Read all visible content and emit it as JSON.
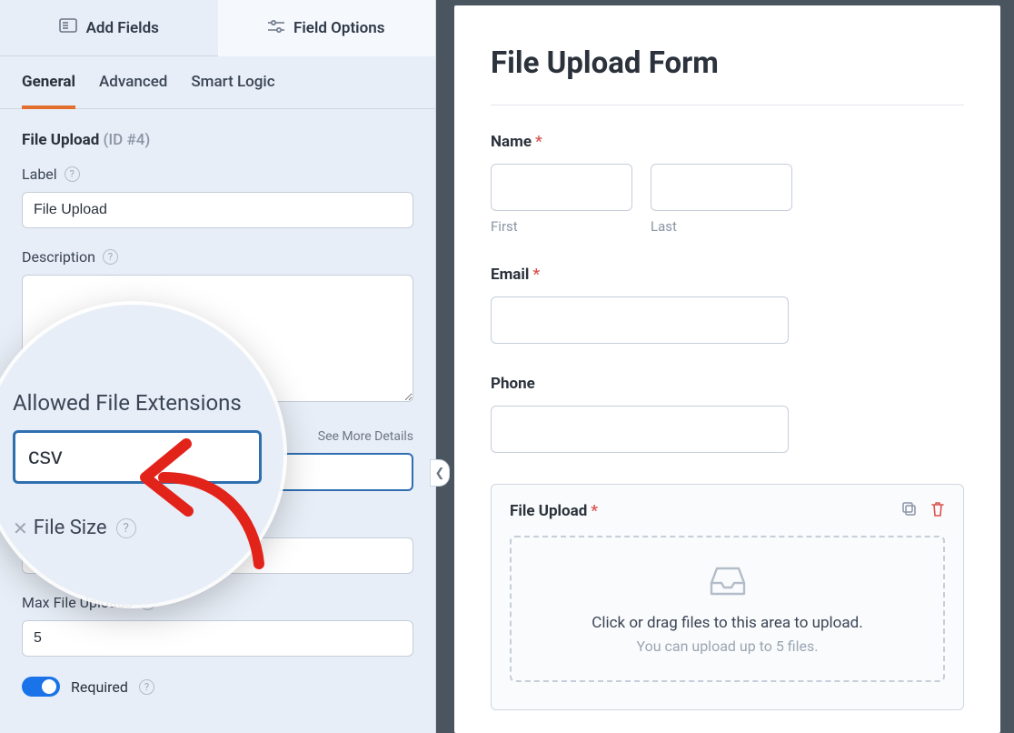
{
  "top_tabs": {
    "add_fields": "Add Fields",
    "field_options": "Field Options"
  },
  "sub_tabs": {
    "general": "General",
    "advanced": "Advanced",
    "smart_logic": "Smart Logic"
  },
  "field_header": {
    "name": "File Upload",
    "id": "(ID #4)"
  },
  "labels": {
    "label": "Label",
    "description": "Description",
    "allowed_ext": "Allowed File Extensions",
    "see_more": "See More Details",
    "max_size": "Max File Size",
    "max_size_mag": "File Size",
    "max_uploads": "Max File Uploads",
    "required": "Required"
  },
  "values": {
    "label": "File Upload",
    "description": "",
    "allowed_ext": "csv",
    "max_size": "",
    "max_uploads": "5",
    "required": true
  },
  "preview": {
    "title": "File Upload Form",
    "name": "Name",
    "first": "First",
    "last": "Last",
    "email": "Email",
    "phone": "Phone",
    "file_upload": "File Upload",
    "drop_line1": "Click or drag files to this area to upload.",
    "drop_line2": "You can upload up to 5 files."
  }
}
